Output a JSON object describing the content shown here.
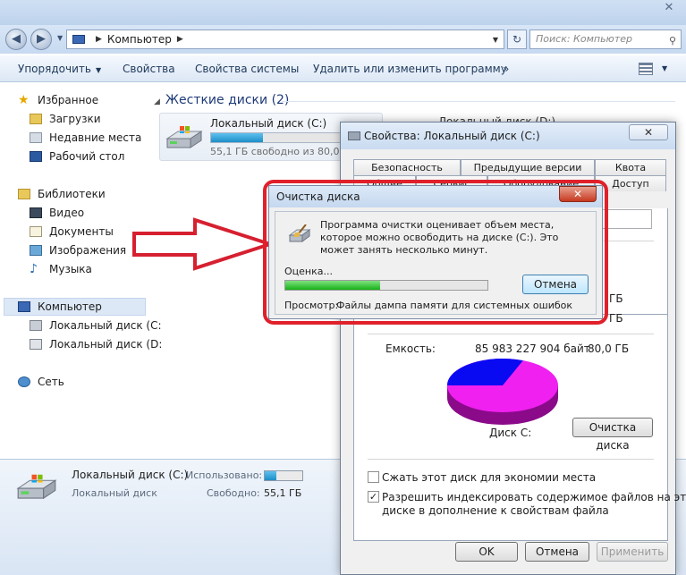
{
  "explorer": {
    "address": {
      "location": "Компьютер",
      "search_placeholder": "Поиск: Компьютер"
    },
    "toolbar": {
      "organize": "Упорядочить",
      "properties": "Свойства",
      "system_properties": "Свойства системы",
      "uninstall": "Удалить или изменить программу",
      "more": "»"
    },
    "nav": {
      "favorites": "Избранное",
      "downloads": "Загрузки",
      "recent": "Недавние места",
      "desktop": "Рабочий стол",
      "libraries": "Библиотеки",
      "video": "Видео",
      "documents": "Документы",
      "images": "Изображения",
      "music": "Музыка",
      "computer": "Компьютер",
      "drive_c": "Локальный диск (C:",
      "drive_d": "Локальный диск (D:",
      "network": "Сеть"
    },
    "content": {
      "section_title": "Жесткие диски (2)",
      "drive_c": {
        "name": "Локальный диск (C:)",
        "free_text": "55,1 ГБ свободно из 80,0 ГБ",
        "used_fraction": 0.31
      },
      "drive_d": {
        "name": "Локальный диск (D:)"
      }
    },
    "details": {
      "name": "Локальный диск (C:)",
      "type": "Локальный диск",
      "used_label": "Использовано:",
      "free_label": "Свободно:",
      "free_value": "55,1 ГБ",
      "used_fraction": 0.31
    }
  },
  "properties": {
    "title": "Свойства: Локальный диск (C:)",
    "tabs_top": [
      "Безопасность",
      "Предыдущие версии",
      "Квота"
    ],
    "tabs_bottom": [
      "Общие",
      "Сервис",
      "Оборудование",
      "Доступ"
    ],
    "partial_gb_1": "ГБ",
    "partial_gb_2": "ГБ",
    "capacity_label": "Емкость:",
    "capacity_bytes": "85 983 227 904 байт",
    "capacity_gb": "80,0 ГБ",
    "disk_label": "Диск C:",
    "cleanup_button": "Очистка диска",
    "compress_label": "Сжать этот диск для экономии места",
    "compress_checked": false,
    "index_label_1": "Разрешить индексировать содержимое файлов на этом",
    "index_label_2": "диске в дополнение к свойствам файла",
    "index_checked": true,
    "ok": "OK",
    "cancel": "Отмена",
    "apply": "Применить",
    "colors": {
      "used": "#0a0af2",
      "free": "#f020f0"
    }
  },
  "cleanup_dialog": {
    "title": "Очистка диска",
    "close": "✕",
    "message": "Программа очистки оценивает объем места, которое можно освободить на диске  (C:). Это может занять несколько минут.",
    "estimate_label": "Оценка...",
    "progress": 0.47,
    "cancel": "Отмена",
    "scan_label": "Просмотр:",
    "scan_value": "Файлы дампа памяти для системных ошибок"
  }
}
